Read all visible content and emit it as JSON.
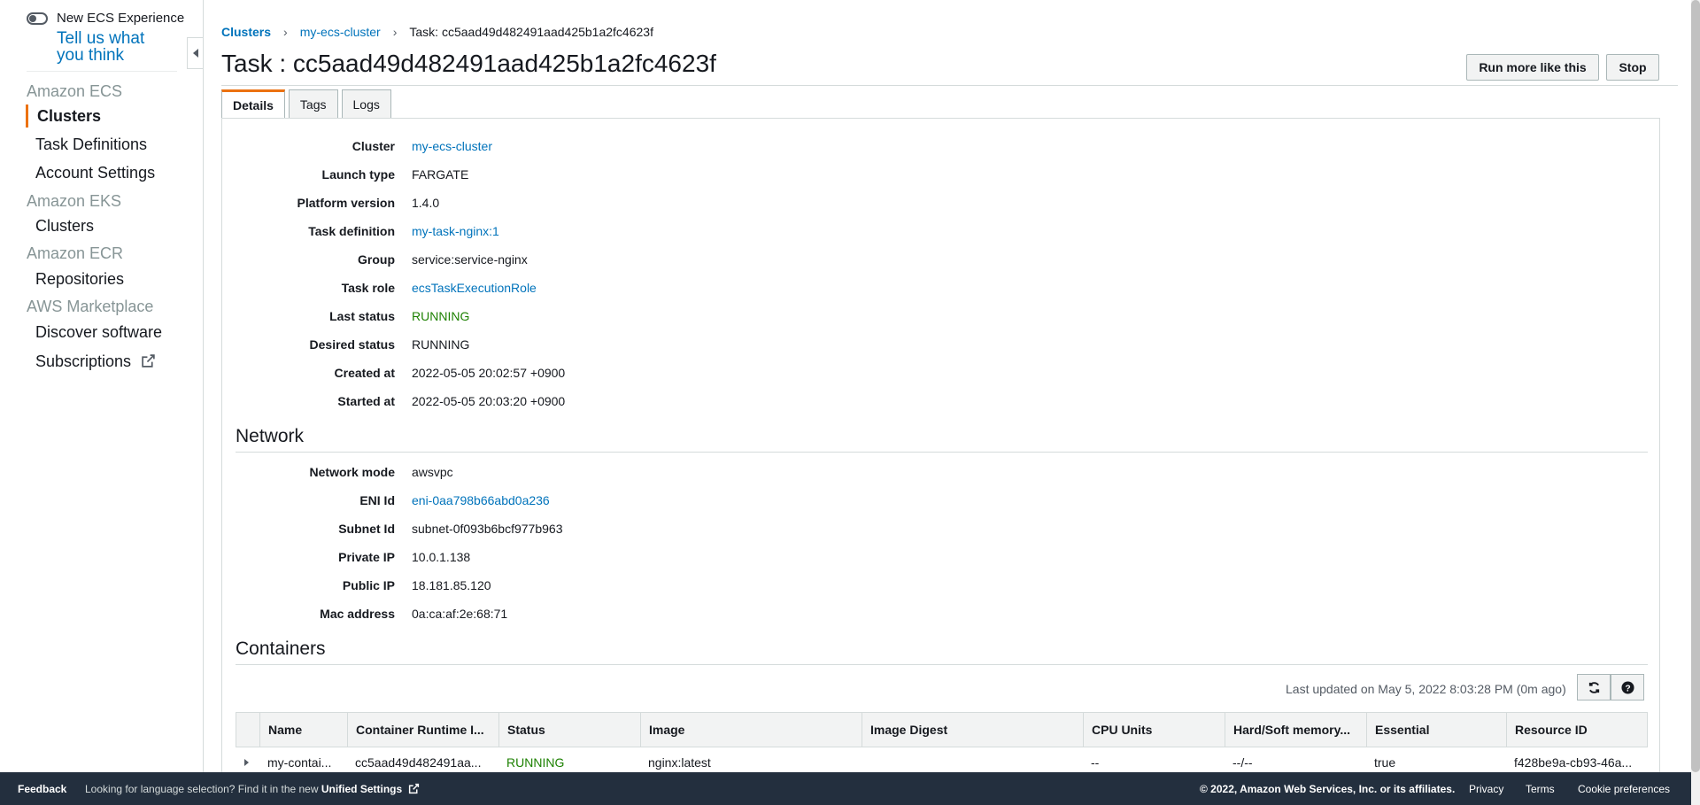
{
  "sidebar": {
    "toggle_label": "New ECS Experience",
    "tell_link": "Tell us what you think",
    "sections": [
      {
        "title": "Amazon ECS",
        "items": [
          "Clusters",
          "Task Definitions",
          "Account Settings"
        ]
      },
      {
        "title": "Amazon EKS",
        "items": [
          "Clusters"
        ]
      },
      {
        "title": "Amazon ECR",
        "items": [
          "Repositories"
        ]
      },
      {
        "title": "AWS Marketplace",
        "items": [
          "Discover software",
          "Subscriptions"
        ]
      }
    ]
  },
  "breadcrumb": [
    "Clusters",
    "my-ecs-cluster",
    "Task: cc5aad49d482491aad425b1a2fc4623f"
  ],
  "page_title": "Task : cc5aad49d482491aad425b1a2fc4623f",
  "buttons": {
    "run_more": "Run more like this",
    "stop": "Stop"
  },
  "tabs": [
    "Details",
    "Tags",
    "Logs"
  ],
  "details": [
    {
      "key": "Cluster",
      "value": "my-ecs-cluster"
    },
    {
      "key": "Launch type",
      "value": "FARGATE"
    },
    {
      "key": "Platform version",
      "value": "1.4.0"
    },
    {
      "key": "Task definition",
      "value": "my-task-nginx:1"
    },
    {
      "key": "Group",
      "value": "service:service-nginx"
    },
    {
      "key": "Task role",
      "value": "ecsTaskExecutionRole"
    },
    {
      "key": "Last status",
      "value": "RUNNING"
    },
    {
      "key": "Desired status",
      "value": "RUNNING"
    },
    {
      "key": "Created at",
      "value": "2022-05-05 20:02:57 +0900"
    },
    {
      "key": "Started at",
      "value": "2022-05-05 20:03:20 +0900"
    }
  ],
  "network": {
    "title": "Network",
    "rows": [
      {
        "key": "Network mode",
        "value": "awsvpc"
      },
      {
        "key": "ENI Id",
        "value": "eni-0aa798b66abd0a236"
      },
      {
        "key": "Subnet Id",
        "value": "subnet-0f093b6bcf977b963"
      },
      {
        "key": "Private IP",
        "value": "10.0.1.138"
      },
      {
        "key": "Public IP",
        "value": "18.181.85.120"
      },
      {
        "key": "Mac address",
        "value": "0a:ca:af:2e:68:71"
      }
    ]
  },
  "containers": {
    "title": "Containers",
    "last_updated": "Last updated on May 5, 2022 8:03:28 PM (0m ago)",
    "columns": [
      "Name",
      "Container Runtime I...",
      "Status",
      "Image",
      "Image Digest",
      "CPU Units",
      "Hard/Soft memory...",
      "Essential",
      "Resource ID"
    ],
    "rows": [
      [
        "my-contai...",
        "cc5aad49d482491aa...",
        "RUNNING",
        "nginx:latest",
        "",
        "--",
        "--/--",
        "true",
        "f428be9a-cb93-46a..."
      ]
    ]
  },
  "footer": {
    "feedback": "Feedback",
    "lang_prefix": "Looking for language selection? Find it in the new ",
    "lang_link": "Unified Settings",
    "copyright": "© 2022, Amazon Web Services, Inc. or its affiliates.",
    "privacy": "Privacy",
    "terms": "Terms",
    "cookie": "Cookie preferences"
  },
  "colors": {
    "accent": "#ec7211",
    "link": "#0073bb",
    "running": "#1d8102",
    "footer_bg": "#232f3e"
  }
}
